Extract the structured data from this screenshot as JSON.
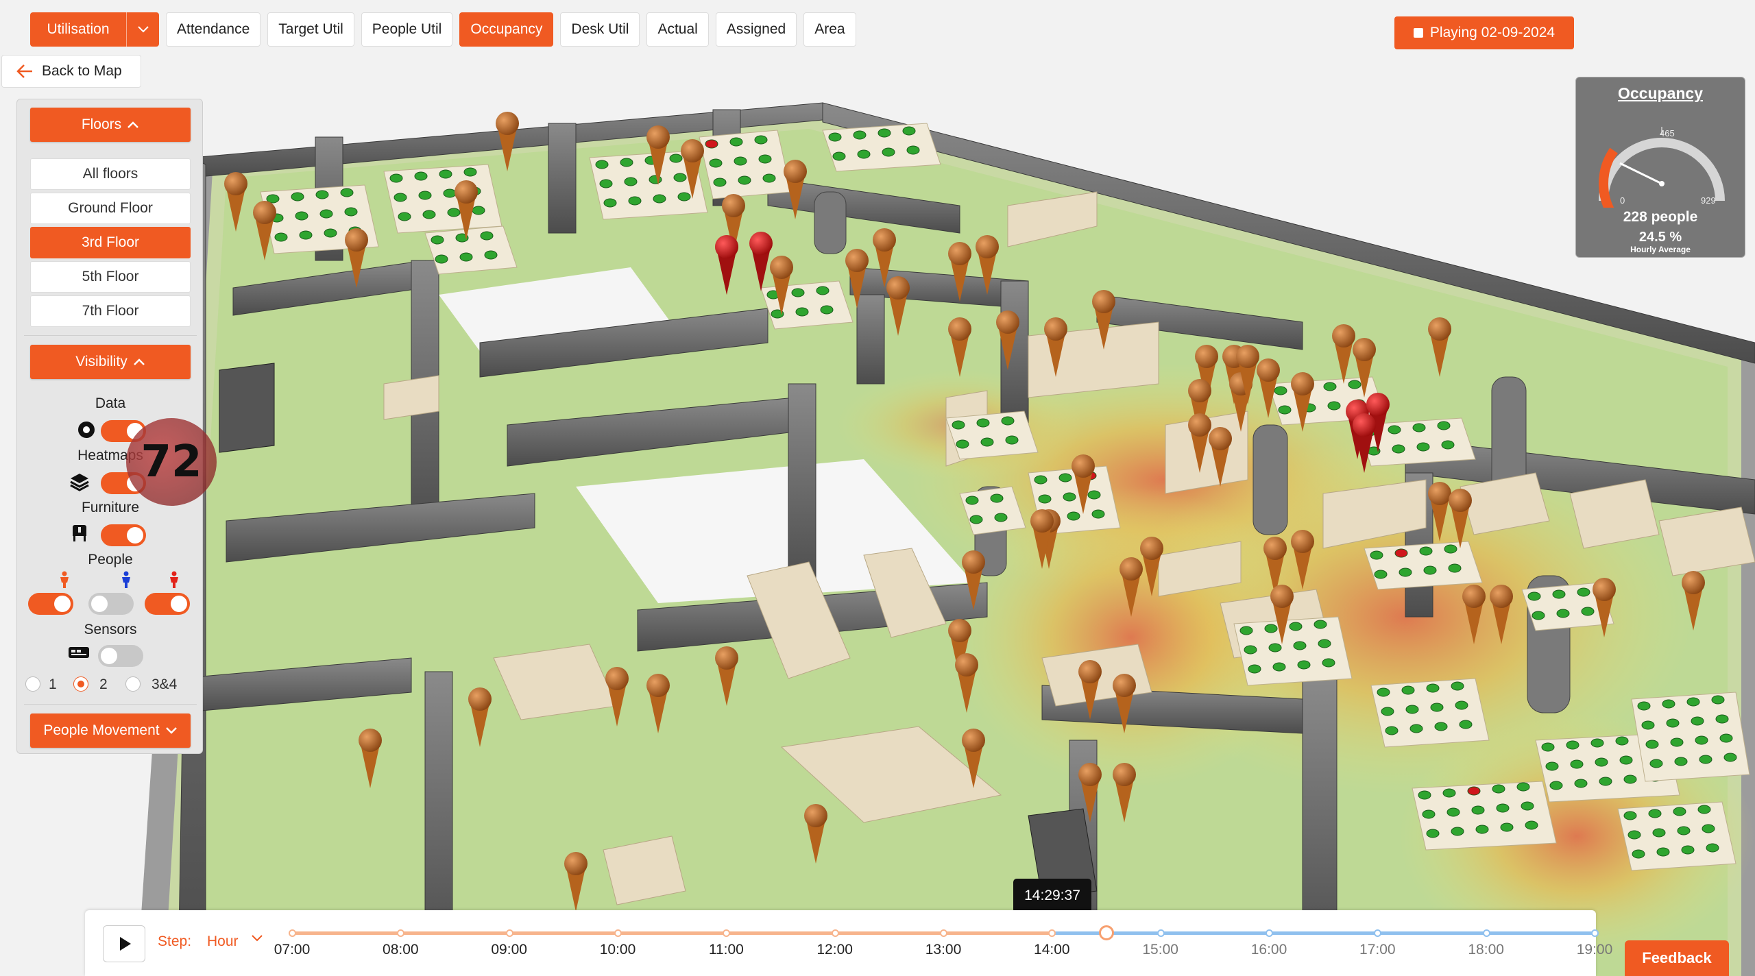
{
  "nav": {
    "utilisation_label": "Utilisation",
    "tabs": [
      {
        "label": "Attendance",
        "active": false
      },
      {
        "label": "Target Util",
        "active": false
      },
      {
        "label": "People Util",
        "active": false
      },
      {
        "label": "Occupancy",
        "active": true
      },
      {
        "label": "Desk Util",
        "active": false
      },
      {
        "label": "Actual",
        "active": false
      },
      {
        "label": "Assigned",
        "active": false
      },
      {
        "label": "Area",
        "active": false
      }
    ]
  },
  "playing_label": "Playing 02-09-2024",
  "back_label": "Back to Map",
  "panel": {
    "floors_label": "Floors",
    "floors": [
      {
        "label": "All floors",
        "active": false
      },
      {
        "label": "Ground Floor",
        "active": false
      },
      {
        "label": "3rd Floor",
        "active": true
      },
      {
        "label": "5th Floor",
        "active": false
      },
      {
        "label": "7th Floor",
        "active": false
      }
    ],
    "visibility_label": "Visibility",
    "data_label": "Data",
    "heatmaps_label": "Heatmaps",
    "furniture_label": "Furniture",
    "people_label": "People",
    "sensors_label": "Sensors",
    "toggles": {
      "data": true,
      "heatmaps": true,
      "furniture": true,
      "people_orange": true,
      "people_blue": false,
      "people_red": true,
      "sensors": false
    },
    "radio_options": [
      "1",
      "2",
      "3&4"
    ],
    "radio_selected": "2",
    "people_movement_label": "People Movement",
    "hover_count": "72"
  },
  "gauge": {
    "title": "Occupancy",
    "min": "0",
    "mid": "465",
    "max": "929",
    "people": "228 people",
    "percent": "24.5 %",
    "subtitle": "Hourly Average",
    "value": 228,
    "max_value": 929
  },
  "timeline": {
    "step_label": "Step:",
    "step_value": "Hour",
    "times": [
      "07:00",
      "08:00",
      "09:00",
      "10:00",
      "11:00",
      "12:00",
      "13:00",
      "14:00",
      "15:00",
      "16:00",
      "17:00",
      "18:00",
      "19:00"
    ],
    "current_time": "14:29:37",
    "current_fraction": 0.625
  },
  "feedback_label": "Feedback",
  "colors": {
    "accent": "#f05a22",
    "desk_free": "#2fa52f",
    "desk_busy": "#d0161c",
    "pin": "#b5631d"
  }
}
